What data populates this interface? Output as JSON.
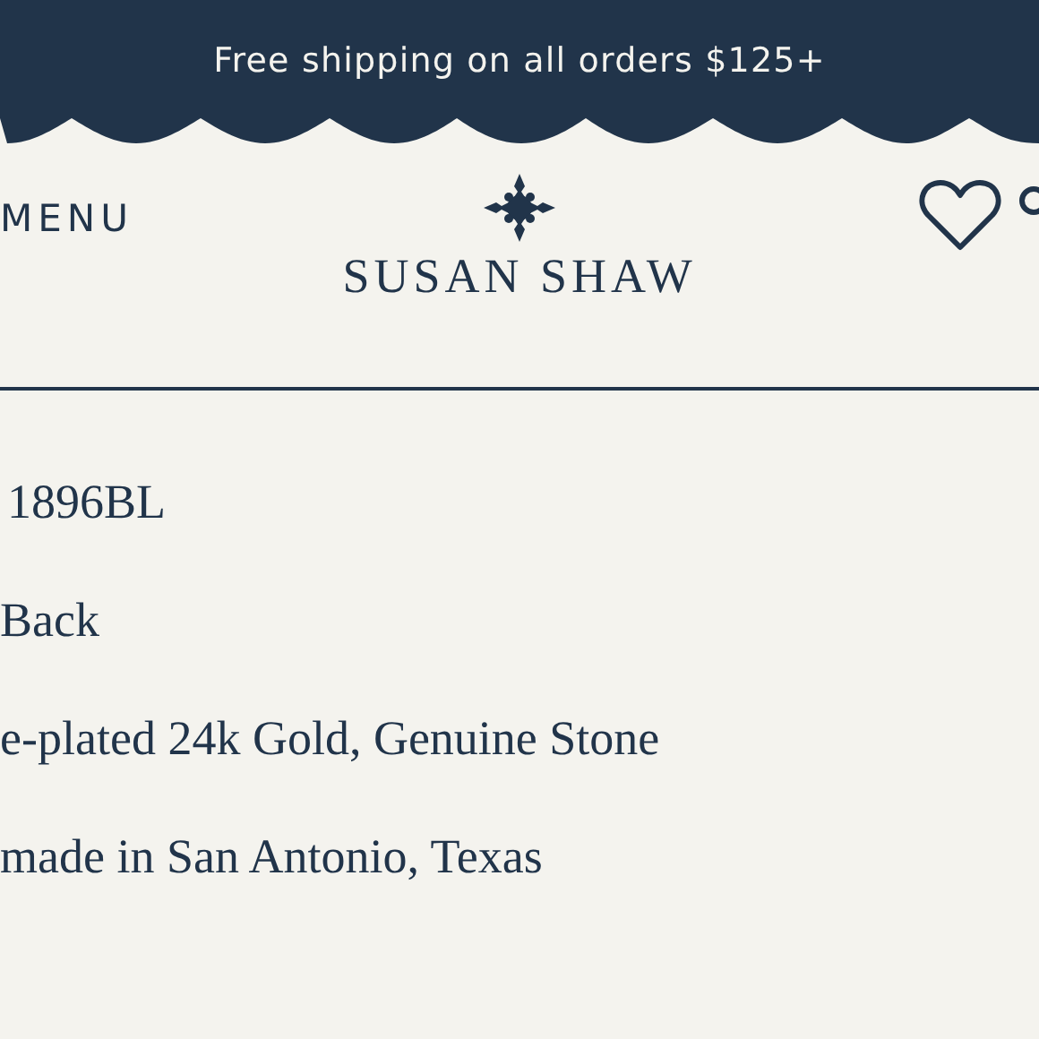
{
  "announcement": "Free shipping on all orders $125+",
  "header": {
    "menu": "MENU",
    "logo": "SUSAN SHAW"
  },
  "details": [
    "1896BL",
    "Back",
    "e-plated 24k Gold, Genuine Stone",
    "made in San Antonio, Texas"
  ]
}
